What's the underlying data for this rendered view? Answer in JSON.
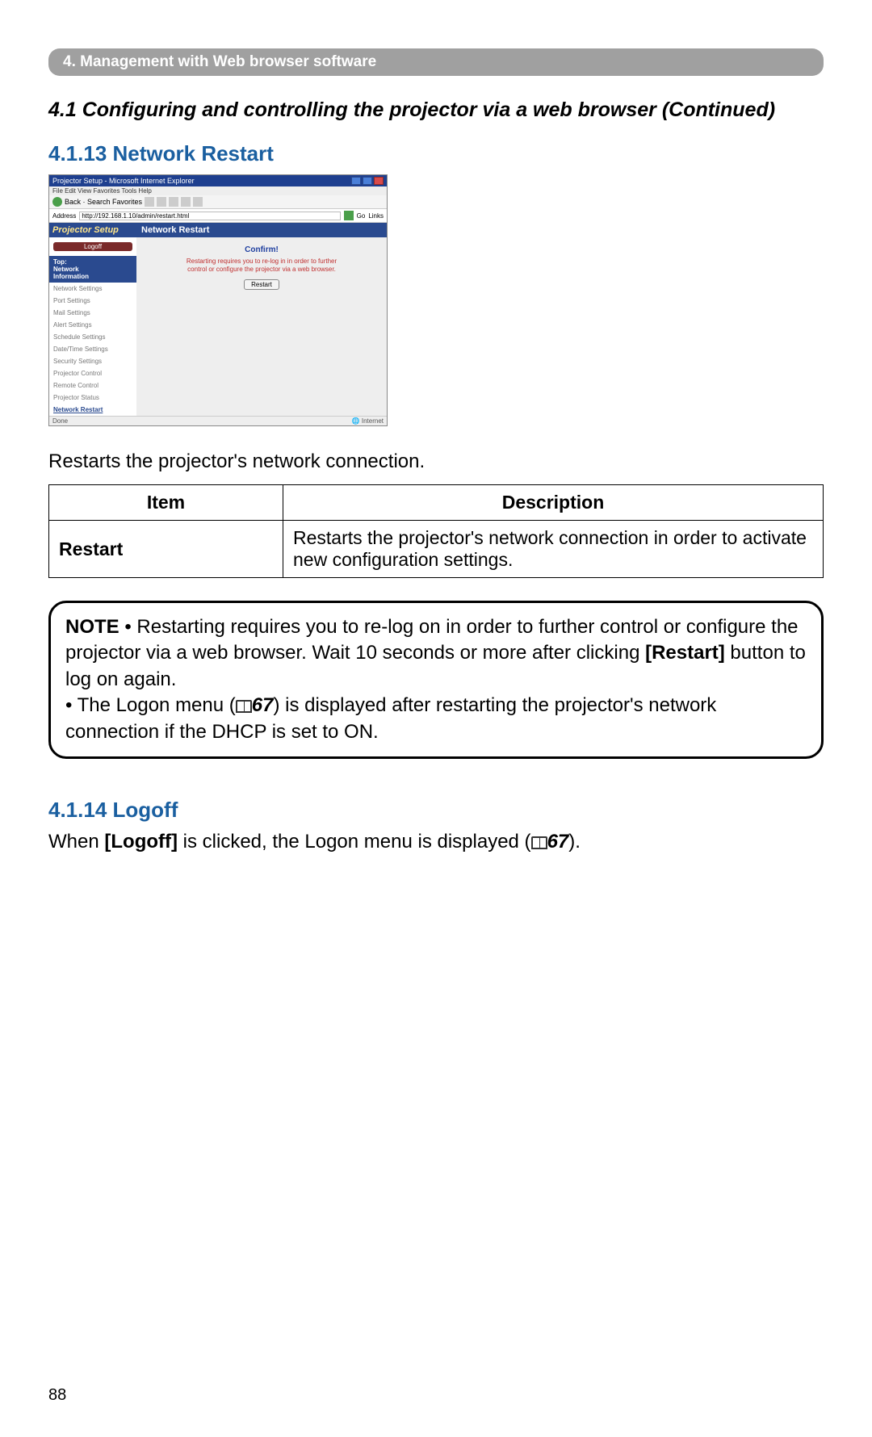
{
  "header": "4. Management with Web browser software",
  "section_title": "4.1 Configuring and controlling the projector via a web browser (Continued)",
  "sub1": "4.1.13 Network Restart",
  "screenshot": {
    "window_title": "Projector Setup - Microsoft Internet Explorer",
    "menubar": "File   Edit   View   Favorites   Tools   Help",
    "toolbar_text": "Back  ·        Search    Favorites",
    "address_label": "Address",
    "address_value": "http://192.168.1.10/admin/restart.html",
    "go": "Go",
    "links": "Links",
    "side_title": "Projector Setup",
    "logoff": "Logoff",
    "top_info": "Top:\nNetwork\nInformation",
    "menu": [
      "Network Settings",
      "Port Settings",
      "Mail Settings",
      "Alert Settings",
      "Schedule Settings",
      "Date/Time Settings",
      "Security Settings",
      "Projector Control",
      "Remote Control",
      "Projector Status",
      "Network Restart"
    ],
    "main_header": "Network Restart",
    "confirm": "Confirm!",
    "warn": "Restarting requires you to re-log in in order to further\ncontrol or configure the projector via a web browser.",
    "restart_btn": "Restart",
    "status_done": "Done",
    "status_inet": "Internet"
  },
  "restarts_line": "Restarts the projector's network connection.",
  "table": {
    "h_item": "Item",
    "h_desc": "Description",
    "row_item": "Restart",
    "row_desc": "Restarts the projector's network connection in order to activate new configuration settings."
  },
  "note": {
    "label": "NOTE",
    "bullet1a": "• Restarting requires you to re-log on in order to further control or configure the projector via a web browser. Wait 10 seconds or more after clicking ",
    "bullet1b": "[Restart]",
    "bullet1c": " button to log on again.",
    "bullet2a": "• The Logon menu (",
    "ref": "67",
    "bullet2b": ") is displayed after restarting the projector's network connection if the DHCP is set to ON."
  },
  "sub2": "4.1.14 Logoff",
  "logoff_line_a": "When ",
  "logoff_line_b": "[Logoff]",
  "logoff_line_c": " is clicked, the Logon menu is displayed (",
  "logoff_ref": "67",
  "logoff_line_d": ").",
  "page_number": "88"
}
